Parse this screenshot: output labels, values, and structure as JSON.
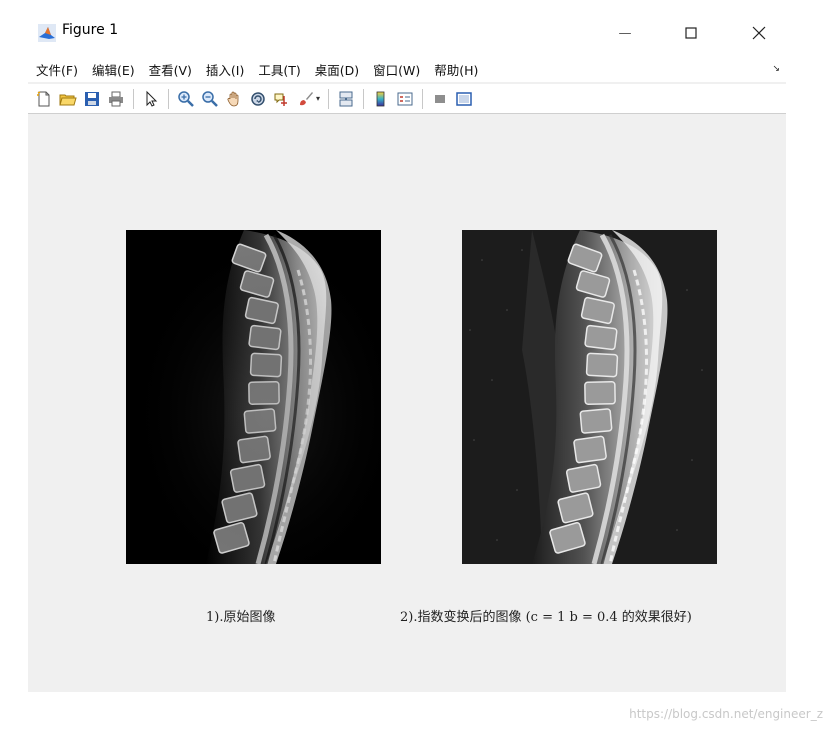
{
  "window": {
    "title": "Figure 1",
    "minimize_glyph": "—",
    "maximize_glyph": "☐",
    "close_glyph": "✕"
  },
  "menubar": {
    "items": [
      {
        "label": "文件(F)"
      },
      {
        "label": "编辑(E)"
      },
      {
        "label": "查看(V)"
      },
      {
        "label": "插入(I)"
      },
      {
        "label": "工具(T)"
      },
      {
        "label": "桌面(D)"
      },
      {
        "label": "窗口(W)"
      },
      {
        "label": "帮助(H)"
      }
    ],
    "overflow_glyph": "↘"
  },
  "toolbar": {
    "buttons": [
      "new-figure-icon",
      "open-file-icon",
      "save-icon",
      "print-icon",
      "pointer-icon",
      "zoom-in-icon",
      "zoom-out-icon",
      "pan-icon",
      "rotate-3d-icon",
      "data-cursor-icon",
      "brush-icon",
      "link-plot-icon",
      "colorbar-icon",
      "legend-icon",
      "hide-plot-tools-icon",
      "show-plot-tools-icon"
    ],
    "dropdown_glyph": "▾"
  },
  "colors": {
    "window_bg": "#f0f0f0",
    "original_image_bg": "#000000",
    "transformed_image_bg": "#1c1c1c",
    "matlab_icon_orange": "#e8742a",
    "matlab_icon_blue": "#2a6fd6"
  },
  "subplots": [
    {
      "caption": "1).原始图像",
      "image": "spine-mri-original"
    },
    {
      "caption": "2).指数变换后的图像 (c = 1 b = 0.4 的效果很好)",
      "image": "spine-mri-exponential-transform"
    }
  ],
  "watermark": "https://blog.csdn.net/engineer_z"
}
